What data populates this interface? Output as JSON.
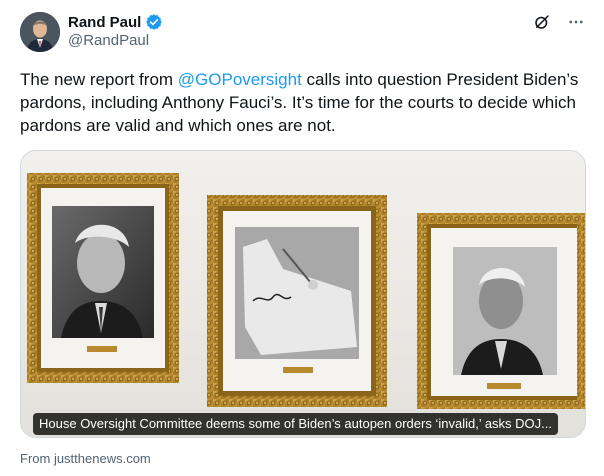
{
  "author": {
    "display_name": "Rand Paul",
    "handle": "@RandPaul",
    "verified_icon": "verified-badge-icon"
  },
  "actions": {
    "grok_icon": "grok-icon",
    "more_icon": "more-options-icon"
  },
  "tweet": {
    "text_before": "The new report from ",
    "mention": "@GOPoversight",
    "text_after": " calls into question President Biden’s pardons, including Anthony Fauci’s. It’s time for the courts to decide which pardons are valid and which ones are not."
  },
  "card": {
    "caption": "House Oversight Committee deems some of Biden’s autopen orders ‘invalid,’ asks DOJ...",
    "source": "From justthenews.com"
  },
  "colors": {
    "accent": "#1d9bf0",
    "text": "#0f1419",
    "muted": "#536471",
    "frame_gold": "#b8892e"
  }
}
